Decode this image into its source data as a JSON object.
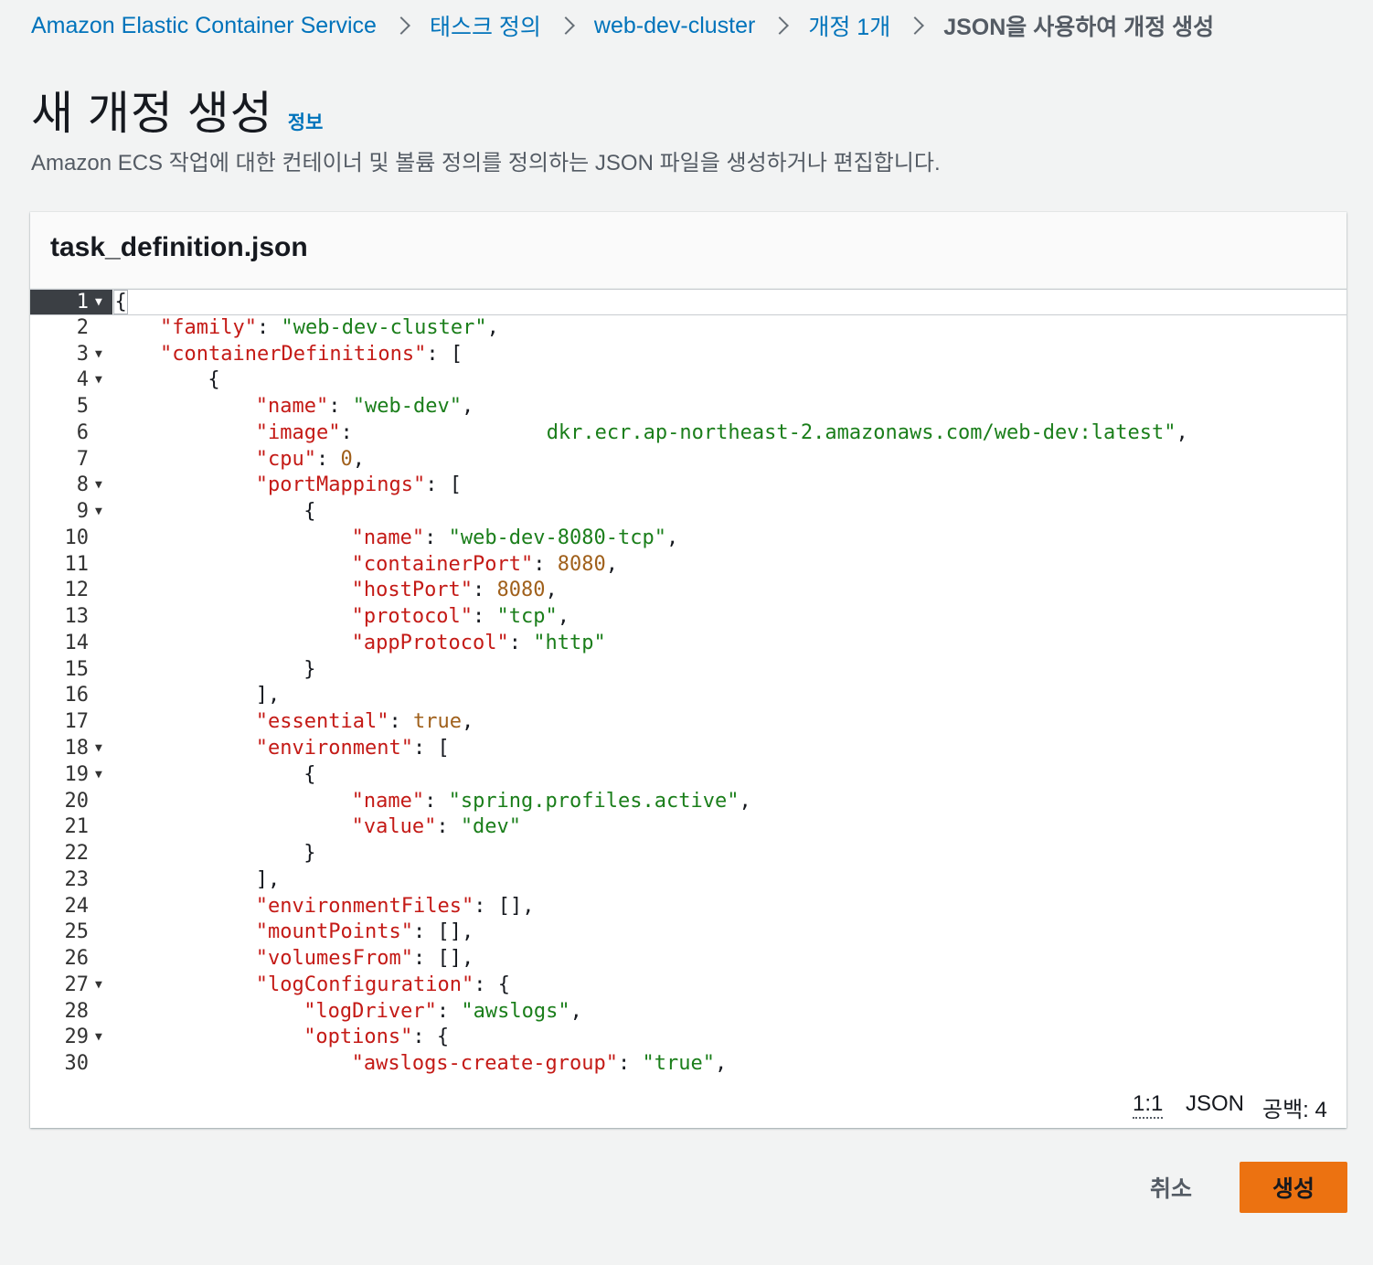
{
  "breadcrumb": [
    {
      "label": "Amazon Elastic Container Service",
      "link": true
    },
    {
      "label": "태스크 정의",
      "link": true
    },
    {
      "label": "web-dev-cluster",
      "link": true
    },
    {
      "label": "개정 1개",
      "link": true
    },
    {
      "label": "JSON을 사용하여 개정 생성",
      "link": false
    }
  ],
  "header": {
    "title": "새 개정 생성",
    "info_link": "정보",
    "description": "Amazon ECS 작업에 대한 컨테이너 및 볼륨 정의를 정의하는 JSON 파일을 생성하거나 편집합니다."
  },
  "editor": {
    "filename": "task_definition.json",
    "lines": [
      {
        "n": "1",
        "fold": true,
        "indent": 0,
        "tokens": [
          [
            "p",
            "{"
          ]
        ]
      },
      {
        "n": "2",
        "fold": false,
        "indent": 1,
        "tokens": [
          [
            "k",
            "\"family\""
          ],
          [
            "p",
            ": "
          ],
          [
            "s",
            "\"web-dev-cluster\""
          ],
          [
            "p",
            ","
          ]
        ]
      },
      {
        "n": "3",
        "fold": true,
        "indent": 1,
        "tokens": [
          [
            "k",
            "\"containerDefinitions\""
          ],
          [
            "p",
            ": ["
          ]
        ]
      },
      {
        "n": "4",
        "fold": true,
        "indent": 2,
        "tokens": [
          [
            "p",
            "{"
          ]
        ]
      },
      {
        "n": "5",
        "fold": false,
        "indent": 3,
        "tokens": [
          [
            "k",
            "\"name\""
          ],
          [
            "p",
            ": "
          ],
          [
            "s",
            "\"web-dev\""
          ],
          [
            "p",
            ","
          ]
        ]
      },
      {
        "n": "6",
        "fold": false,
        "indent": 3,
        "tokens": [
          [
            "k",
            "\"image\""
          ],
          [
            "p",
            ":                "
          ],
          [
            "s",
            "dkr.ecr.ap-northeast-2.amazonaws.com/web-dev:latest\""
          ],
          [
            "p",
            ","
          ]
        ]
      },
      {
        "n": "7",
        "fold": false,
        "indent": 3,
        "tokens": [
          [
            "k",
            "\"cpu\""
          ],
          [
            "p",
            ": "
          ],
          [
            "n",
            "0"
          ],
          [
            "p",
            ","
          ]
        ]
      },
      {
        "n": "8",
        "fold": true,
        "indent": 3,
        "tokens": [
          [
            "k",
            "\"portMappings\""
          ],
          [
            "p",
            ": ["
          ]
        ]
      },
      {
        "n": "9",
        "fold": true,
        "indent": 4,
        "tokens": [
          [
            "p",
            "{"
          ]
        ]
      },
      {
        "n": "10",
        "fold": false,
        "indent": 5,
        "tokens": [
          [
            "k",
            "\"name\""
          ],
          [
            "p",
            ": "
          ],
          [
            "s",
            "\"web-dev-8080-tcp\""
          ],
          [
            "p",
            ","
          ]
        ]
      },
      {
        "n": "11",
        "fold": false,
        "indent": 5,
        "tokens": [
          [
            "k",
            "\"containerPort\""
          ],
          [
            "p",
            ": "
          ],
          [
            "n",
            "8080"
          ],
          [
            "p",
            ","
          ]
        ]
      },
      {
        "n": "12",
        "fold": false,
        "indent": 5,
        "tokens": [
          [
            "k",
            "\"hostPort\""
          ],
          [
            "p",
            ": "
          ],
          [
            "n",
            "8080"
          ],
          [
            "p",
            ","
          ]
        ]
      },
      {
        "n": "13",
        "fold": false,
        "indent": 5,
        "tokens": [
          [
            "k",
            "\"protocol\""
          ],
          [
            "p",
            ": "
          ],
          [
            "s",
            "\"tcp\""
          ],
          [
            "p",
            ","
          ]
        ]
      },
      {
        "n": "14",
        "fold": false,
        "indent": 5,
        "tokens": [
          [
            "k",
            "\"appProtocol\""
          ],
          [
            "p",
            ": "
          ],
          [
            "s",
            "\"http\""
          ]
        ]
      },
      {
        "n": "15",
        "fold": false,
        "indent": 4,
        "tokens": [
          [
            "p",
            "}"
          ]
        ]
      },
      {
        "n": "16",
        "fold": false,
        "indent": 3,
        "tokens": [
          [
            "p",
            "],"
          ]
        ]
      },
      {
        "n": "17",
        "fold": false,
        "indent": 3,
        "tokens": [
          [
            "k",
            "\"essential\""
          ],
          [
            "p",
            ": "
          ],
          [
            "n",
            "true"
          ],
          [
            "p",
            ","
          ]
        ]
      },
      {
        "n": "18",
        "fold": true,
        "indent": 3,
        "tokens": [
          [
            "k",
            "\"environment\""
          ],
          [
            "p",
            ": ["
          ]
        ]
      },
      {
        "n": "19",
        "fold": true,
        "indent": 4,
        "tokens": [
          [
            "p",
            "{"
          ]
        ]
      },
      {
        "n": "20",
        "fold": false,
        "indent": 5,
        "tokens": [
          [
            "k",
            "\"name\""
          ],
          [
            "p",
            ": "
          ],
          [
            "s",
            "\"spring.profiles.active\""
          ],
          [
            "p",
            ","
          ]
        ]
      },
      {
        "n": "21",
        "fold": false,
        "indent": 5,
        "tokens": [
          [
            "k",
            "\"value\""
          ],
          [
            "p",
            ": "
          ],
          [
            "s",
            "\"dev\""
          ]
        ]
      },
      {
        "n": "22",
        "fold": false,
        "indent": 4,
        "tokens": [
          [
            "p",
            "}"
          ]
        ]
      },
      {
        "n": "23",
        "fold": false,
        "indent": 3,
        "tokens": [
          [
            "p",
            "],"
          ]
        ]
      },
      {
        "n": "24",
        "fold": false,
        "indent": 3,
        "tokens": [
          [
            "k",
            "\"environmentFiles\""
          ],
          [
            "p",
            ": [],"
          ]
        ]
      },
      {
        "n": "25",
        "fold": false,
        "indent": 3,
        "tokens": [
          [
            "k",
            "\"mountPoints\""
          ],
          [
            "p",
            ": [],"
          ]
        ]
      },
      {
        "n": "26",
        "fold": false,
        "indent": 3,
        "tokens": [
          [
            "k",
            "\"volumesFrom\""
          ],
          [
            "p",
            ": [],"
          ]
        ]
      },
      {
        "n": "27",
        "fold": true,
        "indent": 3,
        "tokens": [
          [
            "k",
            "\"logConfiguration\""
          ],
          [
            "p",
            ": {"
          ]
        ]
      },
      {
        "n": "28",
        "fold": false,
        "indent": 4,
        "tokens": [
          [
            "k",
            "\"logDriver\""
          ],
          [
            "p",
            ": "
          ],
          [
            "s",
            "\"awslogs\""
          ],
          [
            "p",
            ","
          ]
        ]
      },
      {
        "n": "29",
        "fold": true,
        "indent": 4,
        "tokens": [
          [
            "k",
            "\"options\""
          ],
          [
            "p",
            ": {"
          ]
        ]
      },
      {
        "n": "30",
        "fold": false,
        "indent": 5,
        "tokens": [
          [
            "k",
            "\"awslogs-create-group\""
          ],
          [
            "p",
            ": "
          ],
          [
            "s",
            "\"true\""
          ],
          [
            "p",
            ","
          ]
        ]
      }
    ],
    "status": {
      "position": "1:1",
      "language": "JSON",
      "indent": "공백: 4"
    }
  },
  "actions": {
    "cancel": "취소",
    "create": "생성"
  },
  "colors": {
    "link": "#0073bb",
    "primary_button": "#ec7211",
    "json_key": "#c41a16",
    "json_string": "#1a7e1a",
    "json_number": "#a0601b",
    "active_gutter": "#3b3f44"
  }
}
